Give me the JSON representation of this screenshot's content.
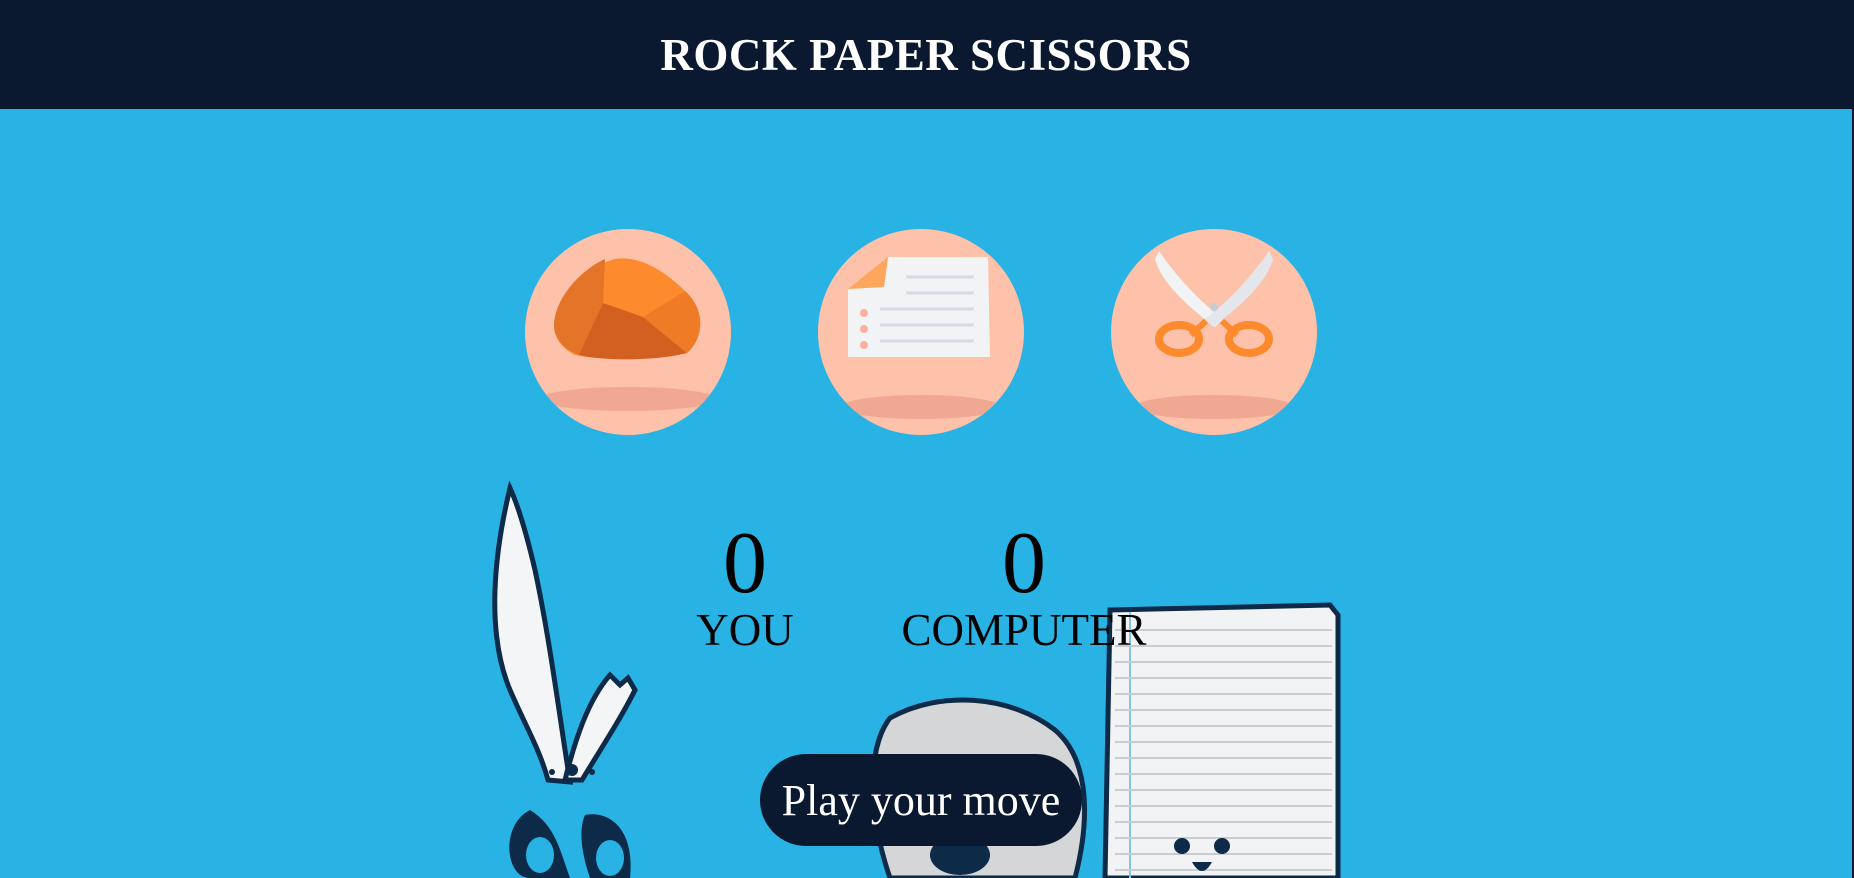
{
  "header": {
    "title": "ROCK PAPER SCISSORS"
  },
  "choices": [
    {
      "name": "rock",
      "icon": "rock-icon"
    },
    {
      "name": "paper",
      "icon": "paper-icon"
    },
    {
      "name": "scissors",
      "icon": "scissors-icon"
    }
  ],
  "scoreboard": {
    "user": {
      "score": "0",
      "label": "YOU"
    },
    "computer": {
      "score": "0",
      "label": "COMPUTER"
    }
  },
  "message": {
    "text": "Play your move"
  },
  "colors": {
    "background": "#29b3e4",
    "header": "#0a1930",
    "choice_bg": "#fec1a9",
    "accent_orange": "#fd8a2c"
  }
}
